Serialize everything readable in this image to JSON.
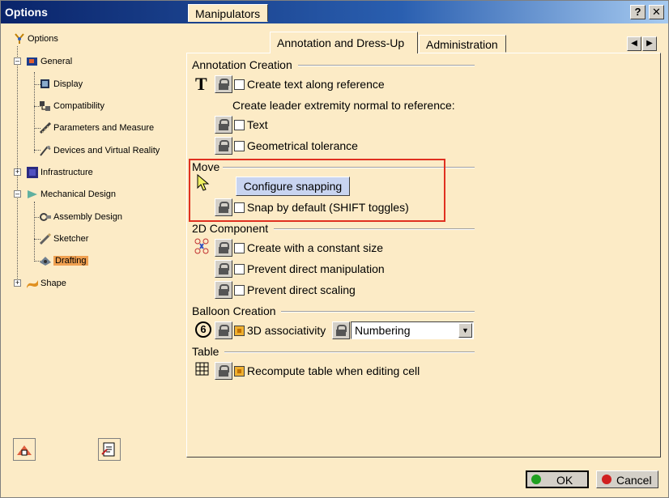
{
  "window": {
    "title": "Options"
  },
  "titlebar": {
    "help": "?",
    "close": "✕"
  },
  "tree": {
    "root": "Options",
    "general": "General",
    "display": "Display",
    "compatibility": "Compatibility",
    "parameters": "Parameters and Measure",
    "devices": "Devices and Virtual Reality",
    "infrastructure": "Infrastructure",
    "mechanical": "Mechanical Design",
    "assembly": "Assembly Design",
    "sketcher": "Sketcher",
    "drafting": "Drafting",
    "shape": "Shape"
  },
  "tabs": {
    "manipulators": "Manipulators",
    "annotation": "Annotation and Dress-Up",
    "administration": "Administration",
    "prev": "◀",
    "next": "▶"
  },
  "annotation_creation": {
    "title": "Annotation Creation",
    "text_icon": "T",
    "create_text_along_reference": "Create text along reference",
    "leader_normal": "Create leader extremity normal to reference:",
    "text": "Text",
    "geometrical_tolerance": "Geometrical tolerance"
  },
  "move": {
    "title": "Move",
    "configure_snapping": "Configure snapping",
    "snap_by_default": "Snap by default (SHIFT toggles)"
  },
  "component_2d": {
    "title": "2D Component",
    "create_constant_size": "Create with a constant size",
    "prevent_manipulation": "Prevent direct manipulation",
    "prevent_scaling": "Prevent direct scaling"
  },
  "balloon": {
    "title": "Balloon Creation",
    "icon": "6",
    "associativity_3d": "3D associativity",
    "numbering": "Numbering",
    "dropdown_arrow": "▼"
  },
  "table": {
    "title": "Table",
    "recompute": "Recompute table when editing cell"
  },
  "footer": {
    "ok": "OK",
    "cancel": "Cancel"
  }
}
